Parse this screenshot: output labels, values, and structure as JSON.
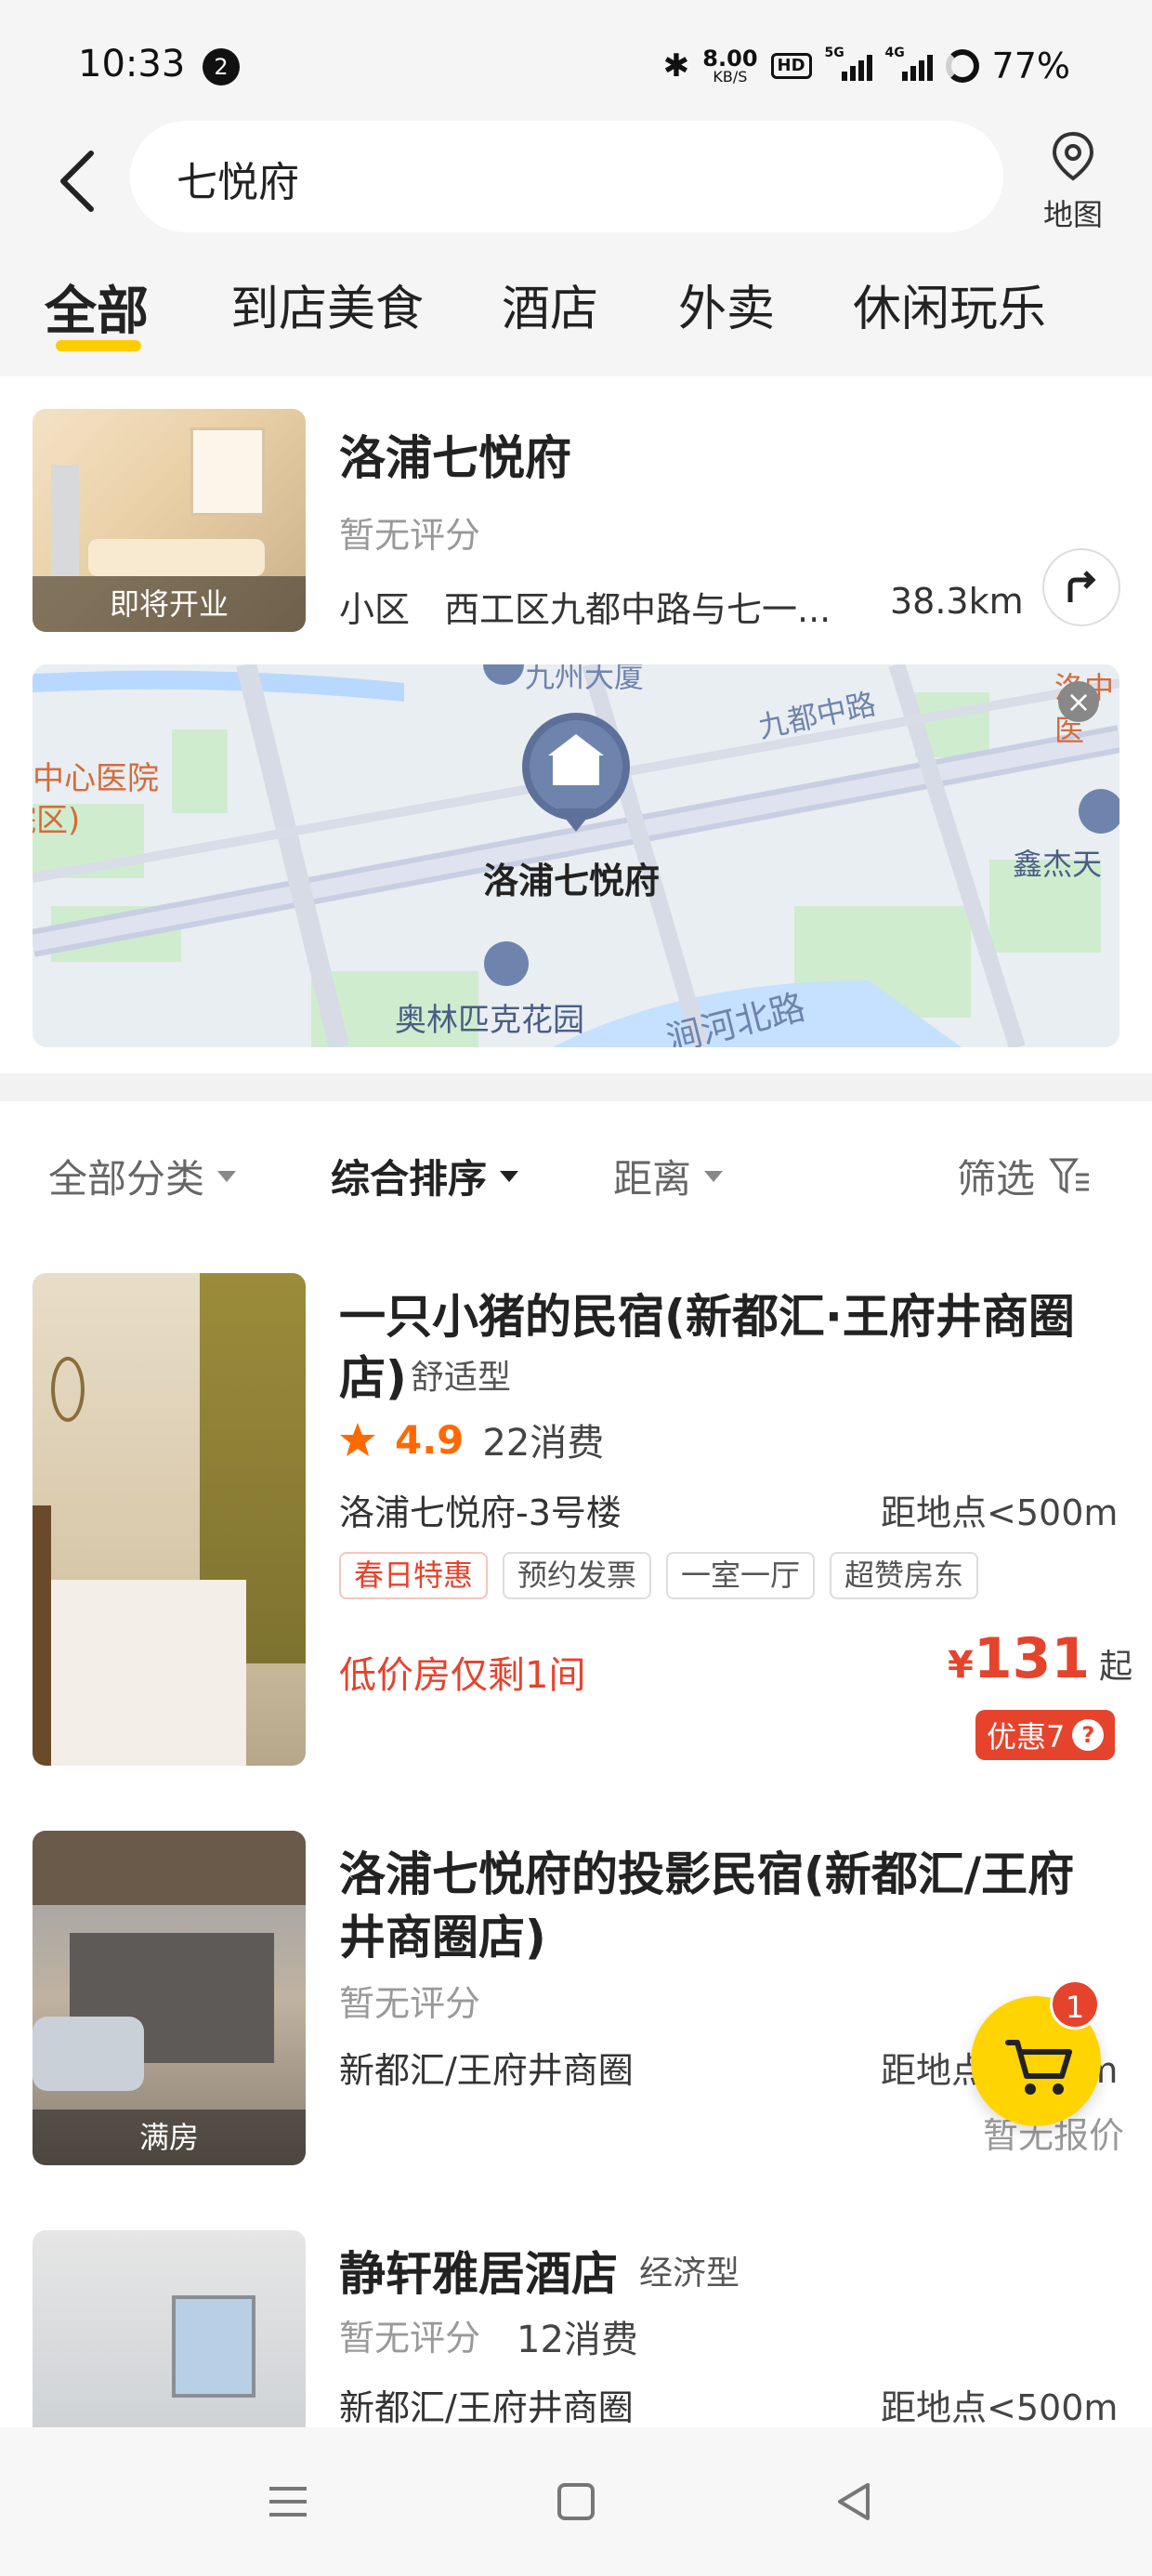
{
  "status_bar": {
    "time": "10:33",
    "notification_count": "2",
    "net_speed_value": "8.00",
    "net_speed_unit": "KB/S",
    "hd_label": "HD",
    "sig1_label": "5G",
    "sig2_label": "4G",
    "battery": "77%"
  },
  "search": {
    "query": "七悦府",
    "map_label": "地图"
  },
  "tabs": [
    {
      "label": "全部"
    },
    {
      "label": "到店美食"
    },
    {
      "label": "酒店"
    },
    {
      "label": "外卖"
    },
    {
      "label": "休闲玩乐"
    }
  ],
  "top_result": {
    "image_tag": "即将开业",
    "title": "洛浦七悦府",
    "rating": "暂无评分",
    "category": "小区",
    "address": "西工区九都中路与七一...",
    "distance": "38.3km",
    "map": {
      "marker_label": "洛浦七悦府",
      "poi_labels": [
        "九州大厦",
        "九都中路",
        "中心医院",
        "院区)",
        "鑫杰天",
        "奥林匹克花园",
        "涧河北路",
        "洛中医"
      ]
    }
  },
  "filters": {
    "category": "全部分类",
    "sort": "综合排序",
    "distance": "距离",
    "filter": "筛选"
  },
  "listings": [
    {
      "title": "一只小猪的民宿(新都汇·王府井商圈",
      "title_line2": "店)",
      "type": "舒适型",
      "rating": "4.9",
      "consumptions": "22消费",
      "location": "洛浦七悦府-3号楼",
      "distance": "距地点<500m",
      "tags": [
        "春日特惠",
        "预约发票",
        "一室一厅",
        "超赞房东"
      ],
      "low_stock": "低价房仅剩1间",
      "price_currency": "¥",
      "price": "131",
      "price_suffix": "起",
      "discount": "优惠7",
      "discount_q": "?"
    },
    {
      "title_line1": "洛浦七悦府的投影民宿(新都汇/王府",
      "title_line2": "井商圈店)",
      "image_tag": "满房",
      "rating": "暂无评分",
      "location": "新都汇/王府井商圈",
      "distance": "距地点<500m",
      "price_note": "暂无报价"
    },
    {
      "title": "静轩雅居酒店",
      "type": "经济型",
      "rating": "暂无评分",
      "consumptions": "12消费",
      "location": "新都汇/王府井商圈",
      "distance": "距地点<500m"
    }
  ],
  "cart": {
    "count": "1"
  },
  "colors": {
    "accent_yellow": "#ffcc00",
    "price_red": "#e6432c",
    "rating_orange": "#ff6a00"
  }
}
